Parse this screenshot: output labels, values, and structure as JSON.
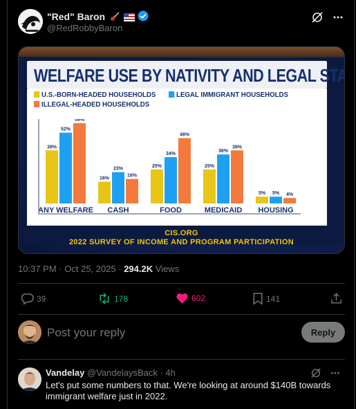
{
  "tweet": {
    "author_name": "\"Red\" Baron",
    "author_handle": "@RedRobbyBaron",
    "timestamp": "10:37 PM · Oct 25, 2025 ·",
    "views_count": "294.2K",
    "views_label": "Views"
  },
  "actions": {
    "replies": "39",
    "reposts": "178",
    "likes": "602",
    "bookmarks": "141"
  },
  "composer": {
    "placeholder": "Post your reply",
    "button_label": "Reply"
  },
  "reply": {
    "name": "Vandelay",
    "handle_time": "@VandelaysBack · 4h",
    "text": "Let's put some numbers to that. We're looking at around $140B towards immigrant welfare just in 2022."
  },
  "colors": {
    "us_born": "#e8c516",
    "legal": "#1ea0f2",
    "illegal": "#f37a3c",
    "like": "#f91880",
    "repost": "#00ba7c"
  },
  "chart_data": {
    "type": "bar",
    "title": "WELFARE USE BY NATIVITY AND LEGAL STATUS",
    "categories": [
      "ANY WELFARE",
      "CASH",
      "FOOD",
      "MEDICAID",
      "HOUSING"
    ],
    "series": [
      {
        "name": "U.S.-BORN-HEADED HOUSEHOLDS",
        "values": [
          39,
          16,
          25,
          25,
          5
        ],
        "labels": [
          "39%",
          "16%",
          "25%",
          "25%",
          "5%"
        ]
      },
      {
        "name": "LEGAL IMMIGRANT HOUSEHOLDS",
        "values": [
          52,
          23,
          34,
          36,
          5
        ],
        "labels": [
          "52%",
          "23%",
          "34%",
          "36%",
          "5%"
        ]
      },
      {
        "name": "ILLEGAL-HEADED HOUSEHOLDS",
        "values": [
          59,
          18,
          48,
          39,
          4
        ],
        "labels": [
          "59%",
          "18%",
          "48%",
          "39%",
          "4%"
        ]
      }
    ],
    "ylim": [
      0,
      62
    ],
    "source_line1": "CIS.ORG",
    "source_line2": "2022 SURVEY OF INCOME AND PROGRAM PARTICIPATION"
  }
}
